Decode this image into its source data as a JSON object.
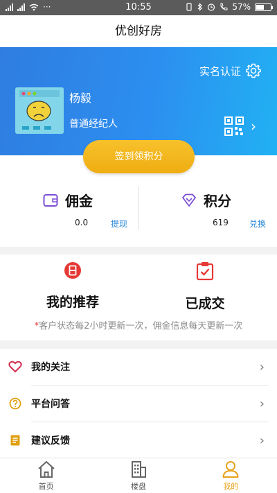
{
  "status_bar": {
    "time": "10:55",
    "battery": "57%",
    "battery_level": 0.57,
    "overflow": "···"
  },
  "app": {
    "title": "优创好房"
  },
  "profile": {
    "verify_label": "实名认证",
    "name": "杨毅",
    "role": "普通经纪人"
  },
  "checkin": {
    "label": "签到领积分"
  },
  "commission": {
    "title": "佣金",
    "value": "0.0",
    "action": "提现"
  },
  "points": {
    "title": "积分",
    "value": "619",
    "action": "兑换"
  },
  "recommend": {
    "mine": "我的推荐",
    "deal": "已成交",
    "note_star": "*",
    "note": "客户状态每2小时更新一次，佣金信息每天更新一次"
  },
  "menu": [
    {
      "label": "我的关注",
      "icon": "heart-icon"
    },
    {
      "label": "平台问答",
      "icon": "question-icon"
    },
    {
      "label": "建议反馈",
      "icon": "feedback-icon"
    }
  ],
  "nav": [
    {
      "label": "首页",
      "icon": "home-icon"
    },
    {
      "label": "楼盘",
      "icon": "building-icon"
    },
    {
      "label": "我的",
      "icon": "person-icon"
    }
  ],
  "colors": {
    "brand_blue": "#2c8ff0",
    "checkin_yellow": "#f2b31c",
    "link_blue": "#2b8ad9",
    "accent_red": "#e53935",
    "nav_active": "#e8a21a"
  }
}
